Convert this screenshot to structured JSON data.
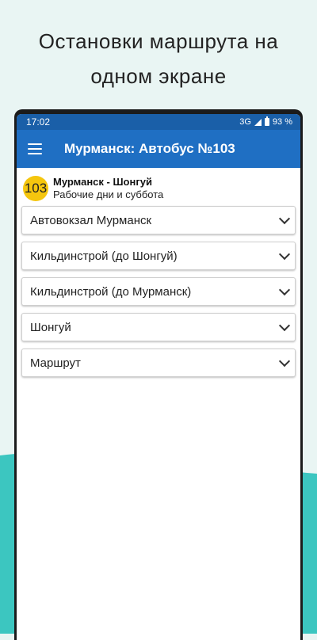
{
  "promo": {
    "line1": "Остановки маршрута на",
    "line2": "одном экране"
  },
  "status_bar": {
    "time": "17:02",
    "network": "3G",
    "battery": "93 %"
  },
  "app_bar": {
    "title": "Мурманск: Автобус №103",
    "menu_icon": "hamburger-menu-icon"
  },
  "route": {
    "number": "103",
    "name": "Мурманск - Шонгуй",
    "schedule": "Рабочие дни и суббота",
    "badge_color": "#f5c60e"
  },
  "stops": [
    {
      "label": "Автовокзал Мурманск"
    },
    {
      "label": "Кильдинстрой (до Шонгуй)"
    },
    {
      "label": "Кильдинстрой (до Мурманск)"
    },
    {
      "label": "Шонгуй"
    },
    {
      "label": "Маршрут"
    }
  ],
  "colors": {
    "status_bar": "#1a5fa8",
    "app_bar": "#1f6fc3",
    "accent_teal": "#3cc6c0"
  }
}
